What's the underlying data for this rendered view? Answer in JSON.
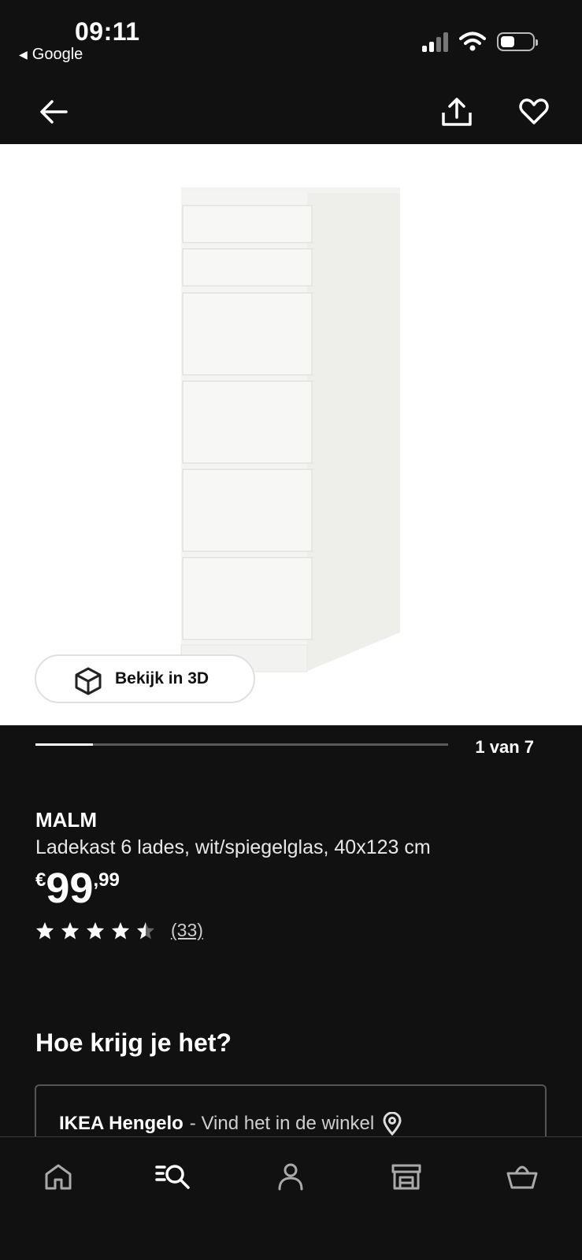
{
  "status_bar": {
    "time": "09:11",
    "back_app": "Google"
  },
  "nav": {
    "back_icon": "arrow-left-icon",
    "share_icon": "share-icon",
    "favorite_icon": "heart-icon"
  },
  "gallery": {
    "view_3d_label": "Bekijk in 3D",
    "counter": "1 van 7",
    "progress_fraction": 0.14
  },
  "product": {
    "name": "MALM",
    "description": "Ladekast 6 lades, wit/spiegelglas, 40x123 cm",
    "price_currency": "€",
    "price_integer": "99",
    "price_decimal": ",99",
    "rating": 4.5,
    "review_count": "(33)"
  },
  "delivery": {
    "title": "Hoe krijg je het?",
    "store_name": "IKEA Hengelo",
    "store_note": " - Vind het in de winkel"
  },
  "tabbar": {
    "items": [
      "home-icon",
      "search-icon",
      "account-icon",
      "store-icon",
      "basket-icon"
    ]
  },
  "colors": {
    "background": "#111111",
    "text": "#ffffff",
    "image_bg": "#ffffff"
  }
}
